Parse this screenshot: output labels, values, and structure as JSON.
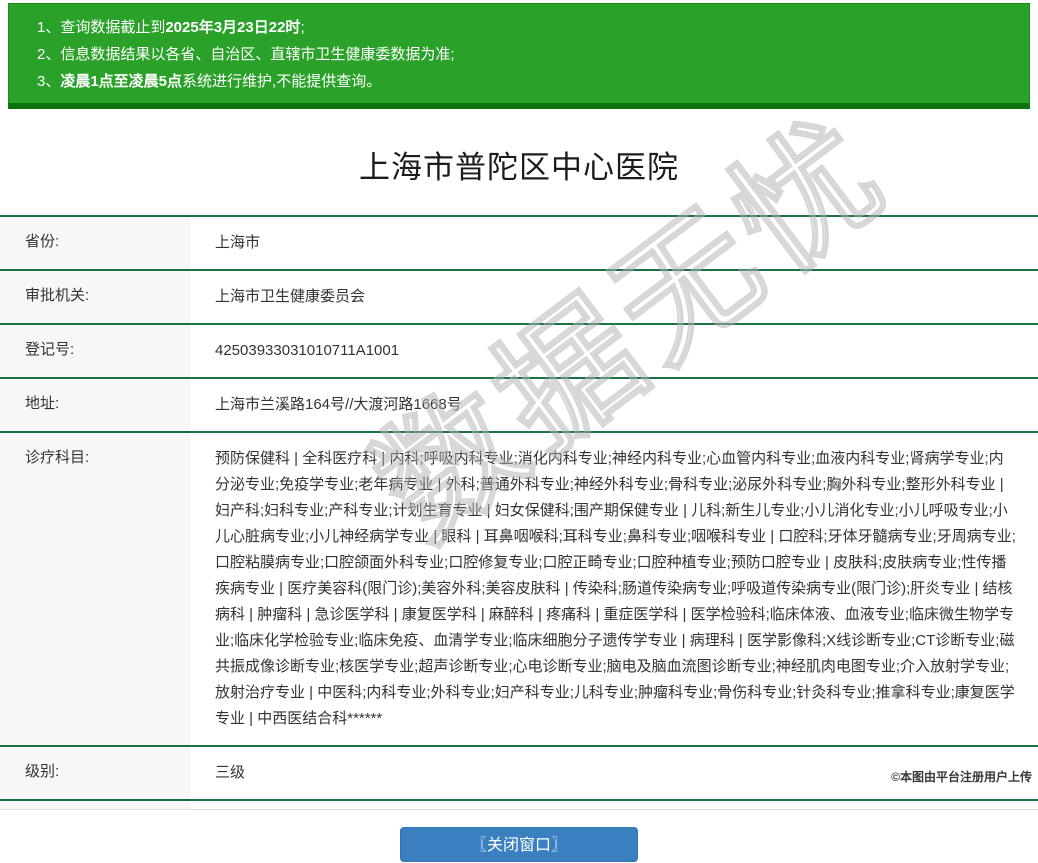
{
  "notice_banner": {
    "bg_color": "#2aa22a",
    "bottom_edge_color": "#0e720e",
    "lines": [
      {
        "prefix": "1、查询数据截止到",
        "bold": "2025年3月23日22时",
        "suffix": ";"
      },
      {
        "prefix": "2、信息数据结果以各省、自治区、直辖市卫生健康委数据为准;",
        "bold": "",
        "suffix": ""
      },
      {
        "prefix": "3、",
        "bold": "凌晨1点至凌晨5点",
        "suffix": "系统进行维护,不能提供查询。"
      }
    ]
  },
  "page_title": "上海市普陀区中心医院",
  "info_table": {
    "divider_color": "#1a7144",
    "label_bg_color": "#f7f7f7",
    "rows": [
      {
        "label": "省份:",
        "value": "上海市"
      },
      {
        "label": "审批机关:",
        "value": "上海市卫生健康委员会"
      },
      {
        "label": "登记号:",
        "value": "42503933031010711A1001"
      },
      {
        "label": "地址:",
        "value": "上海市兰溪路164号//大渡河路1668号"
      },
      {
        "label": "诊疗科目:",
        "value": "预防保健科 | 全科医疗科 | 内科;呼吸内科专业;消化内科专业;神经内科专业;心血管内科专业;血液内科专业;肾病学专业;内分泌专业;免疫学专业;老年病专业 | 外科;普通外科专业;神经外科专业;骨科专业;泌尿外科专业;胸外科专业;整形外科专业 | 妇产科;妇科专业;产科专业;计划生育专业 | 妇女保健科;围产期保健专业 | 儿科;新生儿专业;小儿消化专业;小儿呼吸专业;小儿心脏病专业;小儿神经病学专业 | 眼科 | 耳鼻咽喉科;耳科专业;鼻科专业;咽喉科专业 | 口腔科;牙体牙髓病专业;牙周病专业;口腔粘膜病专业;口腔颌面外科专业;口腔修复专业;口腔正畸专业;口腔种植专业;预防口腔专业 | 皮肤科;皮肤病专业;性传播疾病专业 | 医疗美容科(限门诊);美容外科;美容皮肤科 | 传染科;肠道传染病专业;呼吸道传染病专业(限门诊);肝炎专业 | 结核病科 | 肿瘤科 | 急诊医学科 | 康复医学科 | 麻醉科 | 疼痛科 | 重症医学科 | 医学检验科;临床体液、血液专业;临床微生物学专业;临床化学检验专业;临床免疫、血清学专业;临床细胞分子遗传学专业 | 病理科 | 医学影像科;X线诊断专业;CT诊断专业;磁共振成像诊断专业;核医学专业;超声诊断专业;心电诊断专业;脑电及脑血流图诊断专业;神经肌肉电图专业;介入放射学专业;放射治疗专业 | 中医科;内科专业;外科专业;妇产科专业;儿科专业;肿瘤科专业;骨伤科专业;针灸科专业;推拿科专业;康复医学专业 | 中西医结合科******"
      },
      {
        "label": "级别:",
        "value": "三级"
      }
    ]
  },
  "close_button": {
    "label": "〖关闭窗口〗",
    "bg_color": "#3a80c1"
  },
  "watermark": {
    "center_text": "数据无忧",
    "credit_text": "©本图由平台注册用户上传"
  }
}
